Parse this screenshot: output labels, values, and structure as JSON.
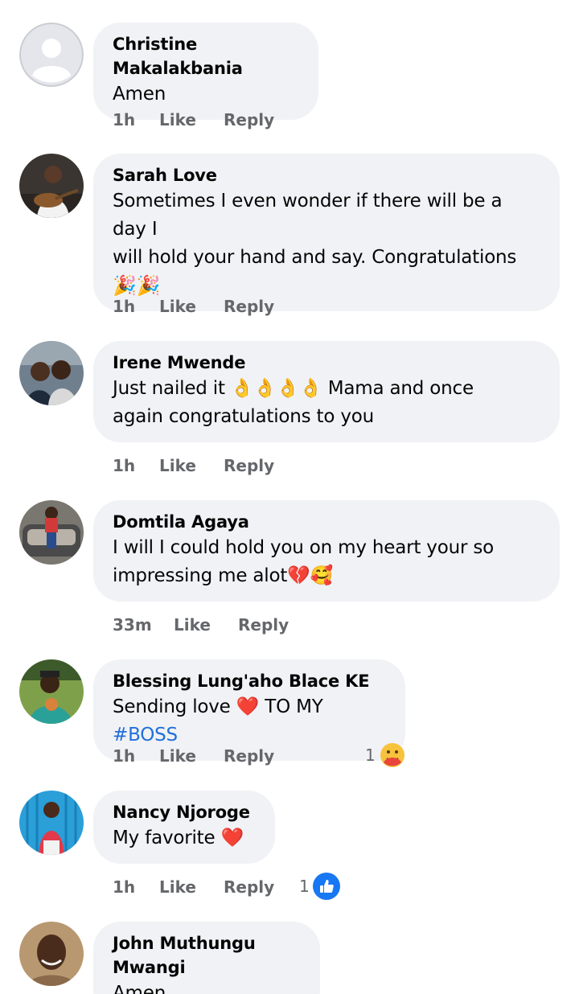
{
  "comments": [
    {
      "name": "Christine Makalakbania",
      "text": "Amen",
      "time": "1h",
      "like": "Like",
      "reply": "Reply"
    },
    {
      "name": "Sarah Love",
      "line1": "Sometimes I even wonder if there will be a day I",
      "line2": "will hold your hand and say. Congratulations",
      "line3": "🎉🎉",
      "time": "1h",
      "like": "Like",
      "reply": "Reply"
    },
    {
      "name": "Irene Mwende",
      "line1": "Just nailed it 👌👌👌👌 Mama and once",
      "line2": "again congratulations to you",
      "time": "1h",
      "like": "Like",
      "reply": "Reply"
    },
    {
      "name": "Domtila Agaya",
      "line1": "I will I could hold you on my heart your so",
      "line2": "impressing me alot💔🥰",
      "time": "33m",
      "like": "Like",
      "reply": "Reply"
    },
    {
      "name": "Blessing Lung'aho Blace KE",
      "text_before": "Sending love ❤️ TO MY ",
      "hashtag": "#BOSS",
      "time": "1h",
      "like": "Like",
      "reply": "Reply",
      "reaction_count": "1",
      "reaction_icon": "hug-emoji"
    },
    {
      "name": "Nancy Njoroge",
      "text": "My favorite ❤️",
      "time": "1h",
      "like": "Like",
      "reply": "Reply",
      "reaction_count": "1",
      "reaction_icon": "like-thumb"
    },
    {
      "name": "John Muthungu Mwangi",
      "text": "Amen"
    }
  ],
  "colors": {
    "bubble": "#f0f2f5",
    "meta_text": "#65676b",
    "hashtag": "#216fdb",
    "like_blue": "#1877f2"
  }
}
